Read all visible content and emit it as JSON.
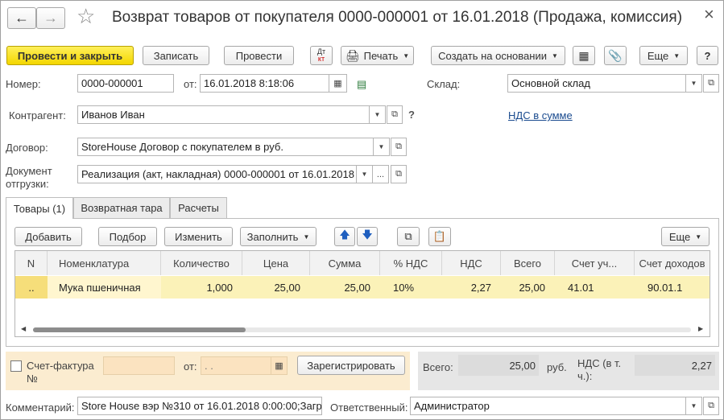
{
  "window": {
    "title": "Возврат товаров от покупателя 0000-000001 от 16.01.2018 (Продажа, комиссия)",
    "close": "×"
  },
  "nav": {
    "back": "←",
    "forward": "→",
    "star": "☆"
  },
  "toolbar": {
    "post_close": "Провести и закрыть",
    "save": "Записать",
    "post": "Провести",
    "dtkt_top": "Дт",
    "dtkt_bottom": "кт",
    "print": "Печать",
    "create_based": "Создать на основании",
    "more": "Еще",
    "help": "?"
  },
  "form": {
    "number_label": "Номер:",
    "number_value": "0000-000001",
    "date_label": "от:",
    "date_value": "16.01.2018  8:18:06",
    "warehouse_label": "Склад:",
    "warehouse_value": "Основной склад",
    "counterparty_label": "Контрагент:",
    "counterparty_value": "Иванов Иван",
    "counterparty_help": "?",
    "vat_link": "НДС в сумме",
    "contract_label": "Договор:",
    "contract_value": "StoreHouse Договор с покупателем в руб.",
    "shipment_label_1": "Документ",
    "shipment_label_2": "отгрузки:",
    "shipment_value": "Реализация (акт, накладная) 0000-000001 от 16.01.2018 8",
    "dots": "..."
  },
  "tabs": [
    {
      "label": "Товары (1)"
    },
    {
      "label": "Возвратная тара"
    },
    {
      "label": "Расчеты"
    }
  ],
  "table_toolbar": {
    "add": "Добавить",
    "pick": "Подбор",
    "edit": "Изменить",
    "fill": "Заполнить",
    "more": "Еще"
  },
  "table": {
    "columns": [
      "N",
      "Номенклатура",
      "Количество",
      "Цена",
      "Сумма",
      "% НДС",
      "НДС",
      "Всего",
      "Счет уч...",
      "Счет доходов"
    ],
    "rows": [
      [
        "..",
        "Мука пшеничная",
        "1,000",
        "25,00",
        "25,00",
        "10%",
        "2,27",
        "25,00",
        "41.01",
        "90.01.1"
      ]
    ]
  },
  "invoice": {
    "label_1": "Счет-фактура",
    "label_2": "№",
    "date_label": "от:",
    "date_value": " .  .",
    "register": "Зарегистрировать"
  },
  "totals": {
    "total_label": "Всего:",
    "total_value": "25,00",
    "currency": "руб.",
    "vat_label_1": "НДС (в т.",
    "vat_label_2": "ч.):",
    "vat_value": "2,27"
  },
  "footer": {
    "comment_label": "Комментарий:",
    "comment_value": "Store House вэр №310 от 16.01.2018 0:00:00;Загр",
    "responsible_label": "Ответственный:",
    "responsible_value": "Администратор"
  },
  "colors": {
    "primary_button": "#f3d600",
    "row_highlight": "#fbf2b8",
    "invoice_panel": "#fbecd0",
    "link": "#1a4b8f"
  }
}
